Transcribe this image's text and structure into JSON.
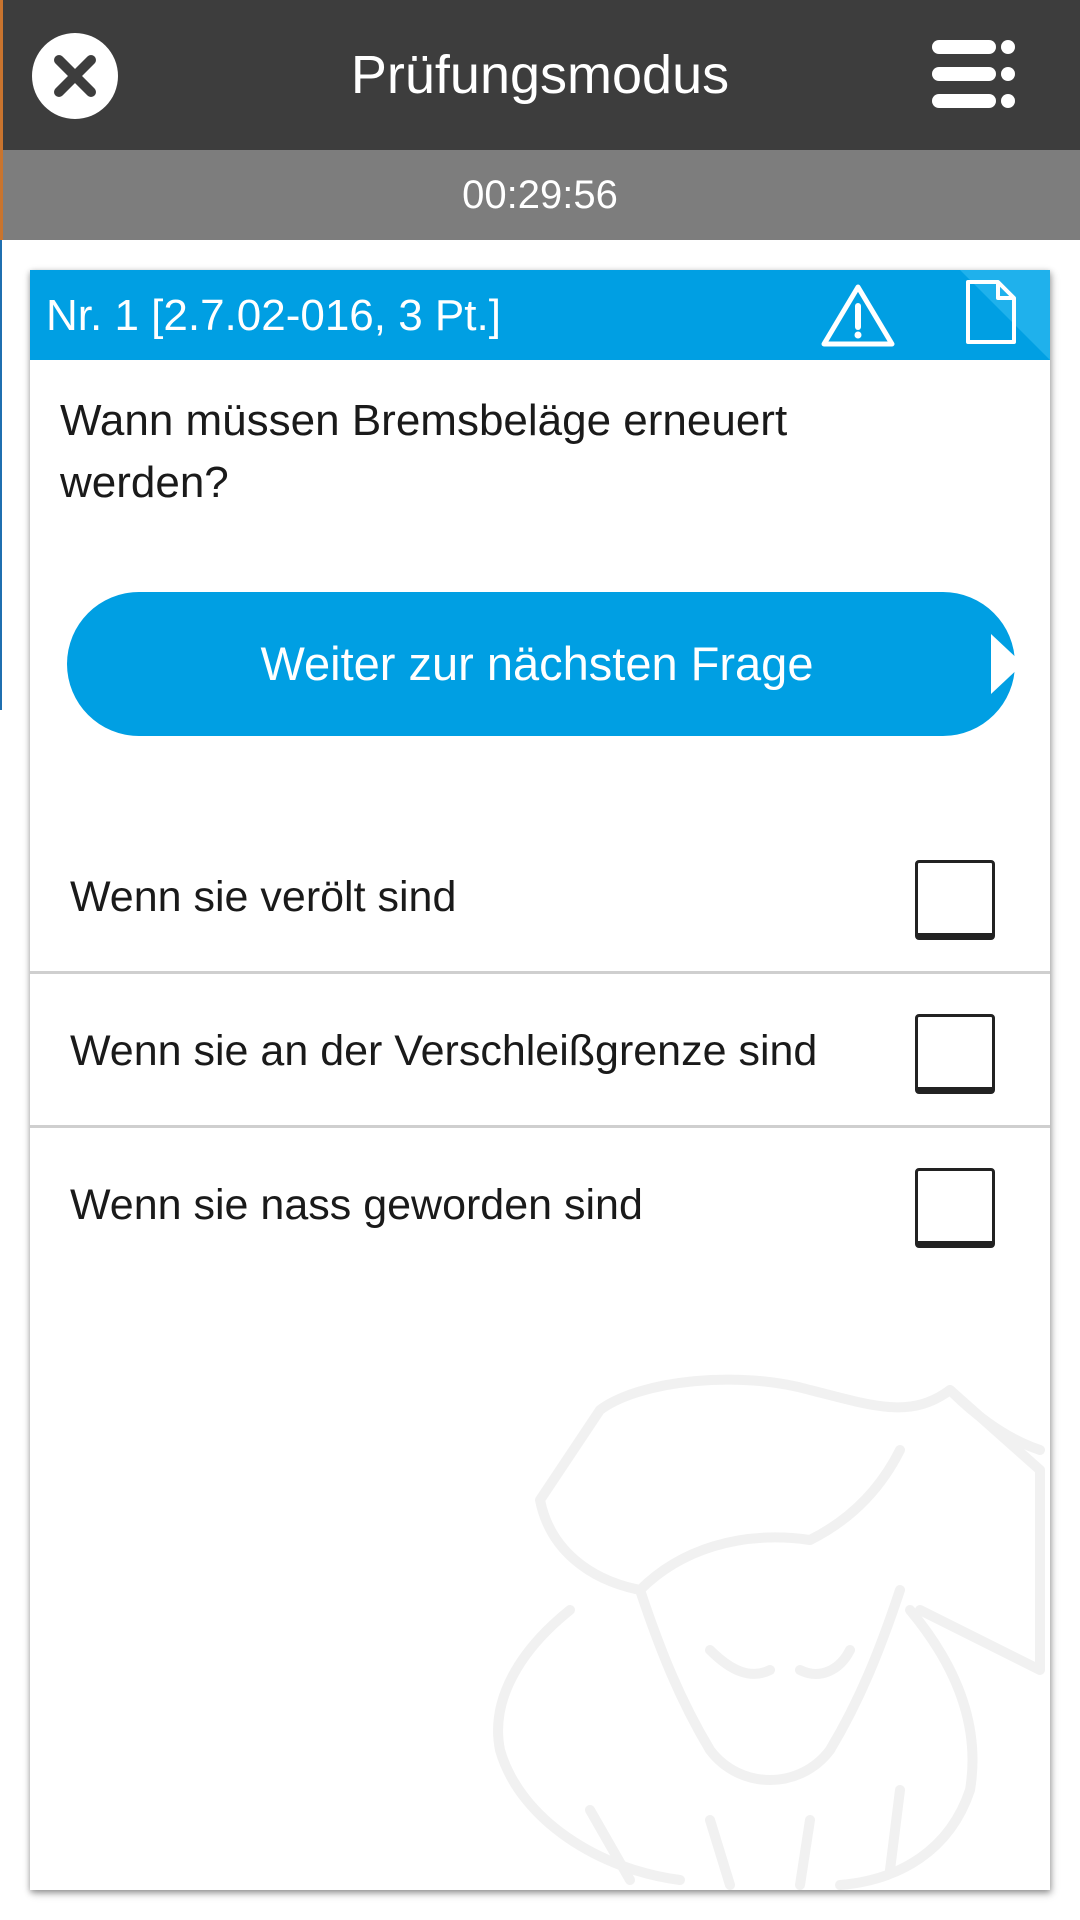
{
  "header": {
    "title": "Prüfungsmodus",
    "close_icon": "close-circle-icon",
    "menu_icon": "menu-list-icon"
  },
  "timer": {
    "value": "00:29:56"
  },
  "question": {
    "id_label": "Nr. 1 [2.7.02-016, 3 Pt.]",
    "warning_icon": "warning-triangle-icon",
    "document_icon": "document-icon",
    "text": "Wann müssen Bremsbeläge erneuert werden?",
    "next_button_label": "Weiter zur nächsten Frage"
  },
  "answers": [
    {
      "text": "Wenn sie verölt sind",
      "checked": false
    },
    {
      "text": "Wenn sie an der Verschleißgrenze sind",
      "checked": false
    },
    {
      "text": "Wenn sie nass geworden sind",
      "checked": false
    }
  ],
  "colors": {
    "appbar": "#3d3d3d",
    "timerbar": "#7d7d7d",
    "accent_blue": "#009fe3",
    "card_background": "#ffffff"
  }
}
